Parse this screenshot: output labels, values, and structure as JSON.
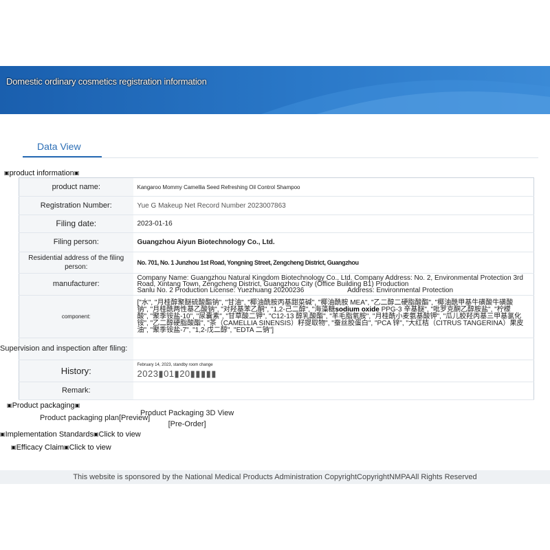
{
  "banner": {
    "title": "Domestic ordinary cosmetics registration information"
  },
  "tab": {
    "label": "Data View"
  },
  "sections": {
    "product_information": "product information",
    "product_packaging": "Product packaging",
    "implementation_standards": "Implementation Standards",
    "efficacy_claim": "Efficacy Claim",
    "click_to_view": "Click to view",
    "supervision_label": "Supervision and inspection after filing:"
  },
  "rows": {
    "product_name": {
      "label": "product name:",
      "value": "Kangaroo Mommy Camellia Seed Refreshing Oil Control Shampoo"
    },
    "registration_number": {
      "label": "Registration Number:",
      "value": "Yue G Makeup Net Record Number 2023007863"
    },
    "filing_date": {
      "label": "Filing date:",
      "value": "2023-01-16"
    },
    "filing_person": {
      "label": "Filing person:",
      "value": "Guangzhou Aiyun Biotechnology Co., Ltd."
    },
    "residential_address": {
      "label": "Residential address of the filing person:",
      "value": "No. 701, No. 1 Junzhou 1st Road, Yongning Street, Zengcheng District, Guangzhou"
    },
    "manufacturer": {
      "label": "manufacturer:",
      "line1": "Company Name: Guangzhou Natural Kingdom Biotechnology Co., Ltd. Company Address: No. 2, Environmental Protection 3rd Road, Xintang Town, Zengcheng District, Guangzhou City (Office Building B1) Production",
      "line2a": "Sanlu No. 2 Production License: Yuezhuang 20200236",
      "line2b": "Address: Environmental Protection"
    },
    "component": {
      "label": "component:",
      "line1": "[\"水\", \"月桂醇聚醚硫酸酯钠\", \"甘油\", \"椰油酰胺丙基甜菜碱\", \"椰油酰胺 MEA\", \"乙二醇二硬脂酸酯\", \"椰油酰甲基牛磺酸牛磺酸",
      "line2": "钠\", \"月桂酰两性基乙酸钠\", \"对羟基苯乙酮\", \"1,2-己二醇\", \"海藻糖",
      "line2b": "PPG-3 辛基醚\", \"吡罗克酮乙醇胺盐\", \"柠檬",
      "overlay": "sodium oxide",
      "line3": "酸\", \"聚季铵盐-10\", \"尿囊素\", \"甘草酸二钾\", \"C12-13 醇乳酸酯\", \"羊毛脂氧胺\", \"月桂酰小麦氨基酸钾\", \"瓜儿胶羟丙基三甲基氯化",
      "line4": "铵\", \"乙二醇硬脂酸酯\", \"茶（CAMELLIA SINENSIS）籽提取物\", \"蚕丝胶蛋白\", \"PCA 锌\", \"大红桔（CITRUS TANGERINA）果皮",
      "line5": "油\", \"聚季铵盐-7\", \"1,2-戊二醇\", \"EDTA 二钠\"]"
    },
    "history": {
      "label": "History:",
      "line1": "February 14, 2023, standby room change",
      "line2": "2023▮01▮20▮▮▮▮▮"
    },
    "remark": {
      "label": "Remark:",
      "value": ""
    }
  },
  "packaging": {
    "plan_label": "Product packaging plan",
    "plan_suffix": "[Preview]",
    "view3d_label": "Product Packaging 3D View",
    "view3d_suffix": "[Pre-Order]"
  },
  "footer": {
    "text": "This website is sponsored by the National Medical Products Administration CopyrightCopyrightNMPAAll Rights Reserved"
  },
  "glyphs": {
    "box": "▣"
  },
  "colors": {
    "banner": "#1a5fae",
    "accent": "#2a6db5"
  }
}
